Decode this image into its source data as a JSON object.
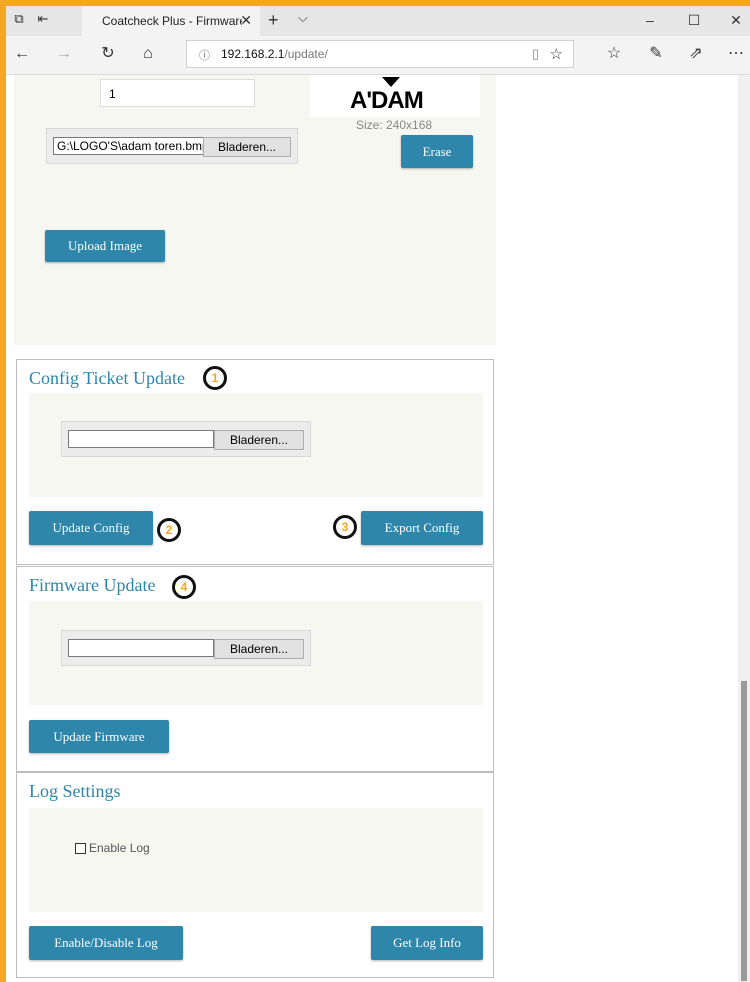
{
  "browser": {
    "tab_title": "Coatcheck Plus - Firmware",
    "url_host": "192.168.2.1",
    "url_path": "/update/"
  },
  "image_section": {
    "number_value": "1",
    "logo_text": "A'DAM",
    "size_text": "Size: 240x168",
    "file_path": "G:\\LOGO'S\\adam toren.bmp",
    "browse_label": "Bladeren...",
    "erase_label": "Erase",
    "upload_label": "Upload Image"
  },
  "config_section": {
    "title": "Config Ticket Update",
    "file_path": "",
    "browse_label": "Bladeren...",
    "update_label": "Update Config",
    "export_label": "Export Config"
  },
  "firmware_section": {
    "title": "Firmware Update",
    "file_path": "",
    "browse_label": "Bladeren...",
    "update_label": "Update Firmware"
  },
  "log_section": {
    "title": "Log Settings",
    "enable_log_label": "Enable Log",
    "enable_log_checked": false,
    "toggle_label": "Enable/Disable Log",
    "get_info_label": "Get Log Info"
  },
  "annotations": [
    "1",
    "2",
    "3",
    "4"
  ],
  "colors": {
    "accent": "#2e86ab",
    "frame": "#f5a623",
    "badge_text": "#f5a623"
  }
}
